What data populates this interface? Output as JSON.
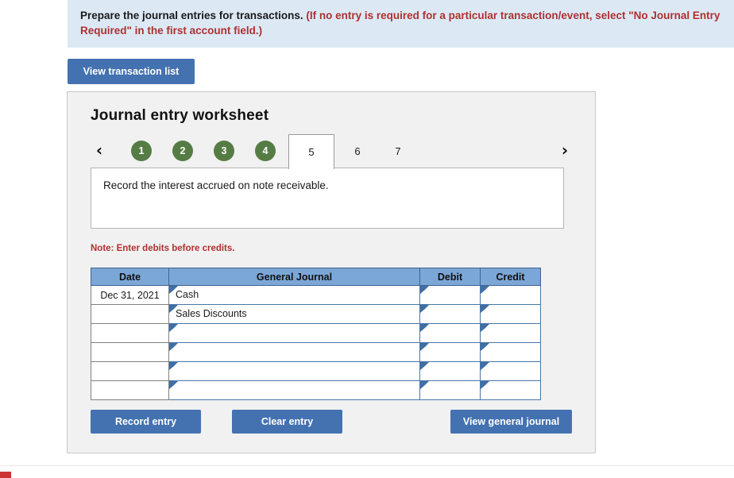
{
  "banner": {
    "instruction_bold": "Prepare the journal entries for transactions.",
    "instruction_red_line1": "(If no entry is required for a particular transaction/event, select \"No Journal Entry",
    "instruction_red_line2": "Required\" in the first account field.)"
  },
  "toolbar": {
    "view_transaction_list_label": "View transaction list"
  },
  "worksheet": {
    "title": "Journal entry worksheet",
    "prev_arrow": "‹",
    "next_arrow": "›",
    "tabs": [
      {
        "label": "1",
        "state": "completed"
      },
      {
        "label": "2",
        "state": "completed"
      },
      {
        "label": "3",
        "state": "completed"
      },
      {
        "label": "4",
        "state": "completed"
      },
      {
        "label": "5",
        "state": "active"
      },
      {
        "label": "6",
        "state": "pending"
      },
      {
        "label": "7",
        "state": "pending"
      }
    ],
    "description": "Record the interest accrued on note receivable.",
    "note": "Note: Enter debits before credits."
  },
  "journal": {
    "columns": [
      "Date",
      "General Journal",
      "Debit",
      "Credit"
    ],
    "rows": [
      {
        "date": "Dec 31, 2021",
        "account": "Cash",
        "debit": "",
        "credit": ""
      },
      {
        "date": "",
        "account": "Sales Discounts",
        "debit": "",
        "credit": ""
      },
      {
        "date": "",
        "account": "",
        "debit": "",
        "credit": ""
      },
      {
        "date": "",
        "account": "",
        "debit": "",
        "credit": ""
      },
      {
        "date": "",
        "account": "",
        "debit": "",
        "credit": ""
      },
      {
        "date": "",
        "account": "",
        "debit": "",
        "credit": ""
      }
    ]
  },
  "actions": {
    "record_entry_label": "Record entry",
    "clear_entry_label": "Clear entry",
    "view_general_journal_label": "View general journal"
  },
  "colors": {
    "banner_bg": "#dce9f5",
    "accent_red": "#b03030",
    "button_blue": "#4472b0",
    "table_header_blue": "#7ba7d7",
    "tab_green": "#567c45",
    "panel_bg": "#f1f1f1",
    "input_border_blue": "#4a76a8",
    "bottom_chip_red": "#cc3333"
  }
}
